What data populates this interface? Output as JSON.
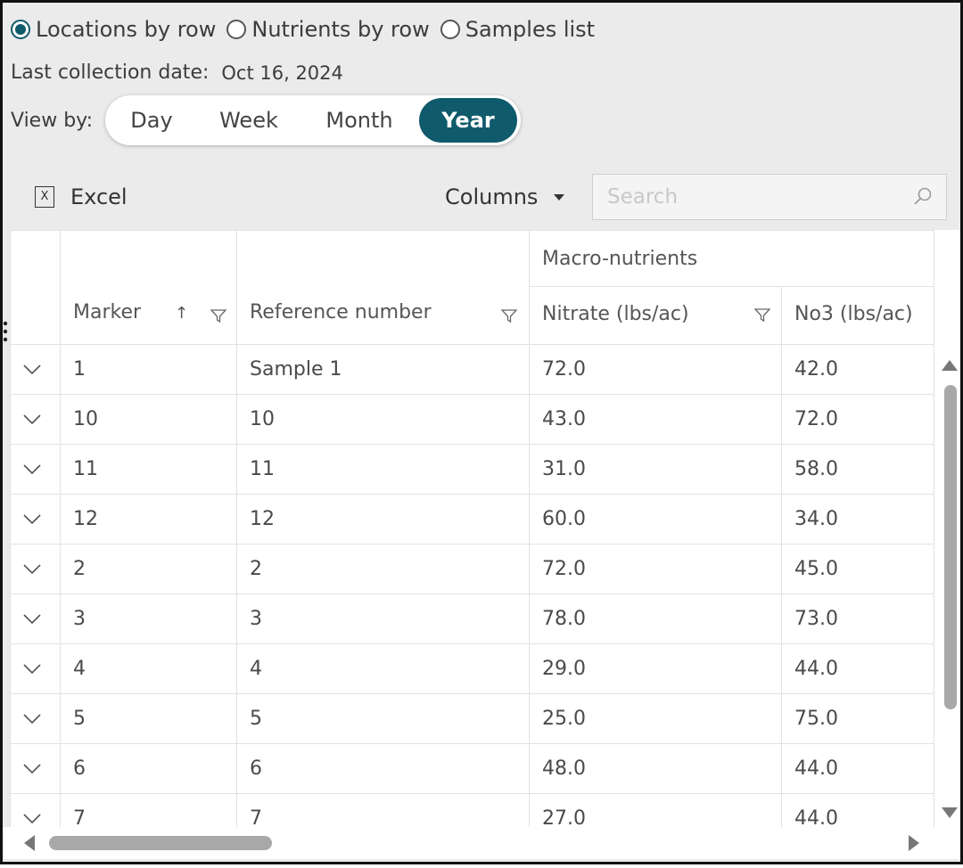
{
  "radios": [
    {
      "label": "Locations by row",
      "checked": true
    },
    {
      "label": "Nutrients by row",
      "checked": false
    },
    {
      "label": "Samples list",
      "checked": false
    }
  ],
  "collection": {
    "label": "Last collection date:",
    "date": "Oct 16, 2024"
  },
  "view_by": {
    "label": "View by:",
    "options": [
      "Day",
      "Week",
      "Month",
      "Year"
    ],
    "selected": "Year"
  },
  "toolbar": {
    "excel_label": "Excel",
    "excel_icon": "excel-export-icon",
    "columns_label": "Columns",
    "search_placeholder": "Search"
  },
  "grid": {
    "group_header": "Macro-nutrients",
    "columns": {
      "marker": "Marker",
      "reference": "Reference number",
      "nitrate": "Nitrate (lbs/ac)",
      "no3": "No3 (lbs/ac)"
    },
    "sort": {
      "column": "Marker",
      "direction": "ascending"
    },
    "rows": [
      {
        "marker": "1",
        "reference": "Sample 1",
        "nitrate": "72.0",
        "no3": "42.0"
      },
      {
        "marker": "10",
        "reference": "10",
        "nitrate": "43.0",
        "no3": "72.0"
      },
      {
        "marker": "11",
        "reference": "11",
        "nitrate": "31.0",
        "no3": "58.0"
      },
      {
        "marker": "12",
        "reference": "12",
        "nitrate": "60.0",
        "no3": "34.0"
      },
      {
        "marker": "2",
        "reference": "2",
        "nitrate": "72.0",
        "no3": "45.0"
      },
      {
        "marker": "3",
        "reference": "3",
        "nitrate": "78.0",
        "no3": "73.0"
      },
      {
        "marker": "4",
        "reference": "4",
        "nitrate": "29.0",
        "no3": "44.0"
      },
      {
        "marker": "5",
        "reference": "5",
        "nitrate": "25.0",
        "no3": "75.0"
      },
      {
        "marker": "6",
        "reference": "6",
        "nitrate": "48.0",
        "no3": "44.0"
      },
      {
        "marker": "7",
        "reference": "7",
        "nitrate": "27.0",
        "no3": "44.0"
      }
    ]
  },
  "colors": {
    "accent": "#0f5a6b",
    "background": "#ebebeb"
  }
}
